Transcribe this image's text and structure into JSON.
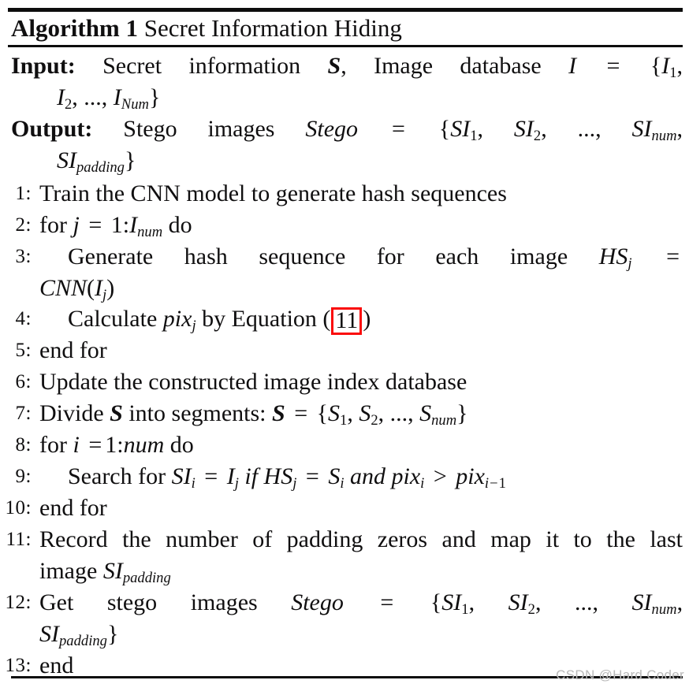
{
  "document": {
    "type": "algorithm-pseudocode-block",
    "title": {
      "label": "Algorithm 1",
      "name": "Secret Information Hiding"
    },
    "io": [
      {
        "key": "input",
        "label": "Input:",
        "line1_text": "Secret information S, Image database I = {I1,",
        "line2_text": "I2, ..., INum}"
      },
      {
        "key": "output",
        "label": "Output:",
        "line1_text": "Stego images Stego = {SI1, SI2, ..., SInum,",
        "line2_text": "SIpadding}"
      }
    ],
    "steps": [
      {
        "num": "1:",
        "text": "Train the CNN model to generate hash sequences"
      },
      {
        "num": "2:",
        "text": "for j = 1:Inum do"
      },
      {
        "num": "3:",
        "text": "Generate hash sequence for each image HSj = CNN(Ij)"
      },
      {
        "num": "4:",
        "text": "Calculate pixj by Equation (11)"
      },
      {
        "num": "5:",
        "text": "end for"
      },
      {
        "num": "6:",
        "text": "Update the constructed image index database"
      },
      {
        "num": "7:",
        "text": "Divide S into segments: S = {S1, S2, ..., Snum}"
      },
      {
        "num": "8:",
        "text": "for i =1:num do"
      },
      {
        "num": "9:",
        "text": "Search for SIi = Ij if HSj = Si and pixi > pixi-1"
      },
      {
        "num": "10:",
        "text": "end for"
      },
      {
        "num": "11:",
        "text": "Record the number of padding zeros and map it to the last image SIpadding"
      },
      {
        "num": "12:",
        "text": "Get stego images Stego = {SI1, SI2, ..., SInum, SIpadding}"
      },
      {
        "num": "13:",
        "text": "end"
      }
    ],
    "annotation": {
      "equation_reference": "11",
      "highlight_color": "#fa0a0a"
    },
    "watermark": "CSDN @Hard Coder"
  }
}
